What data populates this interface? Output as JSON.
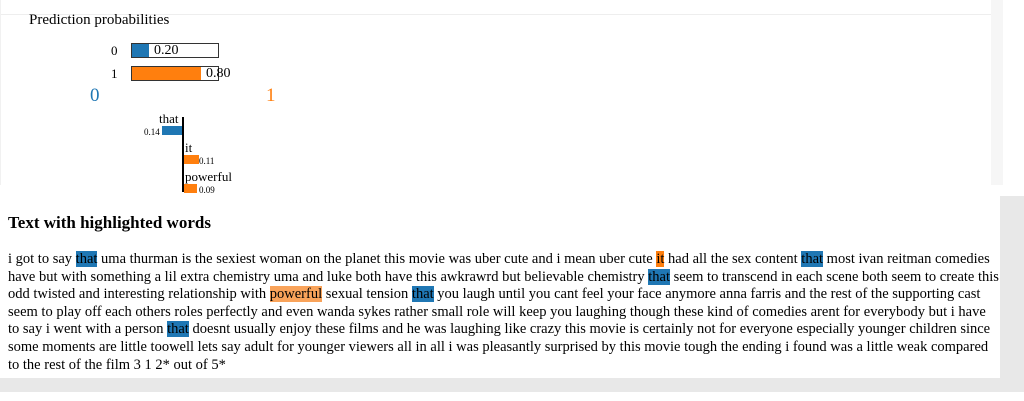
{
  "prediction": {
    "title": "Prediction probabilities",
    "rows": [
      {
        "label": "0",
        "value": 0.2,
        "value_text": "0.20",
        "color": "#1f77b4"
      },
      {
        "label": "1",
        "value": 0.8,
        "value_text": "0.80",
        "color": "#ff7f0e"
      }
    ]
  },
  "classes": {
    "left": {
      "label": "0",
      "color": "#1f77b4"
    },
    "right": {
      "label": "1",
      "color": "#ff7f0e"
    }
  },
  "features": [
    {
      "word": "that",
      "weight": 0.14,
      "weight_text": "0.14",
      "side": "left",
      "color": "#1f77b4"
    },
    {
      "word": "it",
      "weight": 0.11,
      "weight_text": "0.11",
      "side": "right",
      "color": "#ff7f0e"
    },
    {
      "word": "powerful",
      "weight": 0.09,
      "weight_text": "0.09",
      "side": "right",
      "color": "#ff7f0e"
    }
  ],
  "text_section": {
    "heading": "Text with highlighted words",
    "segments": [
      {
        "t": "i got to say "
      },
      {
        "t": "that",
        "hl": "neg"
      },
      {
        "t": " uma thurman is the sexiest woman on the planet this movie was uber cute and i mean uber cute "
      },
      {
        "t": "it",
        "hl": "pos"
      },
      {
        "t": " had all the sex content "
      },
      {
        "t": "that",
        "hl": "neg"
      },
      {
        "t": " most ivan reitman comedies have but with something a lil extra chemistry uma and luke both have this awkrawrd but believable chemistry "
      },
      {
        "t": "that",
        "hl": "neg"
      },
      {
        "t": " seem to transcend in each scene  both seem to create this odd twisted and interesting relationship with "
      },
      {
        "t": "powerful",
        "hl": "pos-light"
      },
      {
        "t": " sexual tension "
      },
      {
        "t": "that",
        "hl": "neg"
      },
      {
        "t": " you laugh until you cant feel your face anymore anna farris and the rest of the supporting cast seem to play off each others roles perfectly and even wanda sykes rather small role will keep you laughing though these kind of comedies arent for everybody but i have to say i went with a person "
      },
      {
        "t": "that",
        "hl": "neg"
      },
      {
        "t": " doesnt usually enjoy these films and he was laughing like crazy this movie is certainly not for everyone especially younger children since some moments are little toowell lets say adult for younger viewers all in all i was pleasantly surprised by this movie tough the ending i found was a little weak compared to the rest of the film 3 1 2* out of 5*"
      }
    ]
  }
}
